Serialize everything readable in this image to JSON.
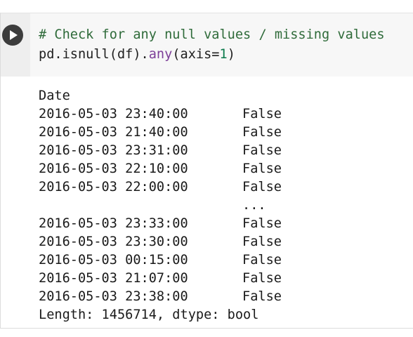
{
  "cell": {
    "run_button_icon": "play-icon",
    "code_line1": "# Check for any null values / missing values",
    "code_line2_pre": "pd.isnull(df).",
    "code_line2_fn": "any",
    "code_line2_mid": "(axis=",
    "code_line2_num": "1",
    "code_line2_post": ")"
  },
  "output": {
    "index_name": "Date",
    "rows": [
      {
        "date": "2016-05-03 23:40:00",
        "value": "False"
      },
      {
        "date": "2016-05-03 21:40:00",
        "value": "False"
      },
      {
        "date": "2016-05-03 23:31:00",
        "value": "False"
      },
      {
        "date": "2016-05-03 22:10:00",
        "value": "False"
      },
      {
        "date": "2016-05-03 22:00:00",
        "value": "False"
      },
      {
        "date": "",
        "value": "..."
      },
      {
        "date": "2016-05-03 23:33:00",
        "value": "False"
      },
      {
        "date": "2016-05-03 23:30:00",
        "value": "False"
      },
      {
        "date": "2016-05-03 00:15:00",
        "value": "False"
      },
      {
        "date": "2016-05-03 21:07:00",
        "value": "False"
      },
      {
        "date": "2016-05-03 23:38:00",
        "value": "False"
      }
    ],
    "footer": "Length: 1456714, dtype: bool"
  },
  "colors": {
    "comment": "#2f6b3a",
    "keyword_fn": "#7d3f98",
    "number": "#0b7a4c",
    "run_button": "#3c3c3c",
    "input_background": "#f7f7f7"
  }
}
